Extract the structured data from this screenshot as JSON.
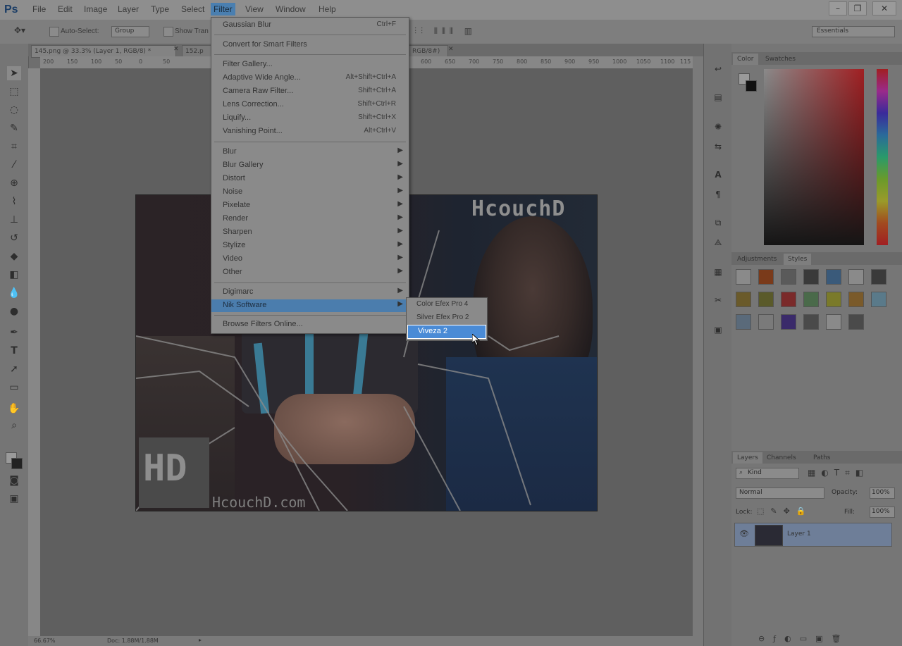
{
  "app": {
    "logo": "Ps"
  },
  "menubar": {
    "items": [
      "File",
      "Edit",
      "Image",
      "Layer",
      "Type",
      "Select",
      "Filter",
      "View",
      "Window",
      "Help"
    ],
    "active": "Filter",
    "window_controls": [
      "–",
      "❐",
      "✕"
    ]
  },
  "options_bar": {
    "auto_select_label": "Auto-Select:",
    "auto_select_value": "Group",
    "show_transform_label": "Show Tran",
    "workspace": "Essentials"
  },
  "tabs": [
    {
      "label": "145.png @ 33.3% (Layer 1, RGB/8) *"
    },
    {
      "label": "152.p"
    },
    {
      "label": "RGB/8#)"
    }
  ],
  "ruler_top_labels": [
    "200",
    "150",
    "100",
    "50",
    "0",
    "50",
    "600",
    "650",
    "700",
    "750",
    "800",
    "850",
    "900",
    "950",
    "1000",
    "1050",
    "1100",
    "115"
  ],
  "filter_menu": {
    "sections": [
      [
        {
          "label": "Gaussian Blur",
          "shortcut": "Ctrl+F"
        }
      ],
      [
        {
          "label": "Convert for Smart Filters",
          "shortcut": ""
        }
      ],
      [
        {
          "label": "Filter Gallery...",
          "shortcut": ""
        },
        {
          "label": "Adaptive Wide Angle...",
          "shortcut": "Alt+Shift+Ctrl+A"
        },
        {
          "label": "Camera Raw Filter...",
          "shortcut": "Shift+Ctrl+A"
        },
        {
          "label": "Lens Correction...",
          "shortcut": "Shift+Ctrl+R"
        },
        {
          "label": "Liquify...",
          "shortcut": "Shift+Ctrl+X"
        },
        {
          "label": "Vanishing Point...",
          "shortcut": "Alt+Ctrl+V"
        }
      ],
      [
        {
          "label": "Blur",
          "submenu": true
        },
        {
          "label": "Blur Gallery",
          "submenu": true
        },
        {
          "label": "Distort",
          "submenu": true
        },
        {
          "label": "Noise",
          "submenu": true
        },
        {
          "label": "Pixelate",
          "submenu": true
        },
        {
          "label": "Render",
          "submenu": true
        },
        {
          "label": "Sharpen",
          "submenu": true
        },
        {
          "label": "Stylize",
          "submenu": true
        },
        {
          "label": "Video",
          "submenu": true
        },
        {
          "label": "Other",
          "submenu": true
        }
      ],
      [
        {
          "label": "Digimarc",
          "submenu": true
        },
        {
          "label": "Nik Software",
          "submenu": true,
          "highlighted": true
        }
      ],
      [
        {
          "label": "Browse Filters Online...",
          "shortcut": ""
        }
      ]
    ]
  },
  "submenu": {
    "items": [
      {
        "label": "Color Efex Pro 4"
      },
      {
        "label": "Silver Efex Pro 2"
      },
      {
        "label": "Viveza 2",
        "selected": true
      }
    ]
  },
  "document": {
    "watermark_top": "HcouchD",
    "watermark_bottom": "HcouchD.com",
    "logo_text": "HD"
  },
  "panels": {
    "color_tabs": [
      "Color",
      "Swatches"
    ],
    "adjust_tabs": [
      "Adjustments",
      "Styles"
    ],
    "layers_tabs": [
      "Layers",
      "Channels",
      "Paths"
    ],
    "kind_label": "Kind",
    "blend_mode": "Normal",
    "opacity_label": "Opacity:",
    "opacity_value": "100%",
    "lock_label": "Lock:",
    "fill_label": "Fill:",
    "fill_value": "100%",
    "layer_name": "Layer 1"
  },
  "status": {
    "zoom": "66.67%",
    "doc": "Doc: 1.88M/1.88M"
  },
  "colors": {
    "accent": "#4a8bd6",
    "menu_highlight": "#4b7dad"
  }
}
